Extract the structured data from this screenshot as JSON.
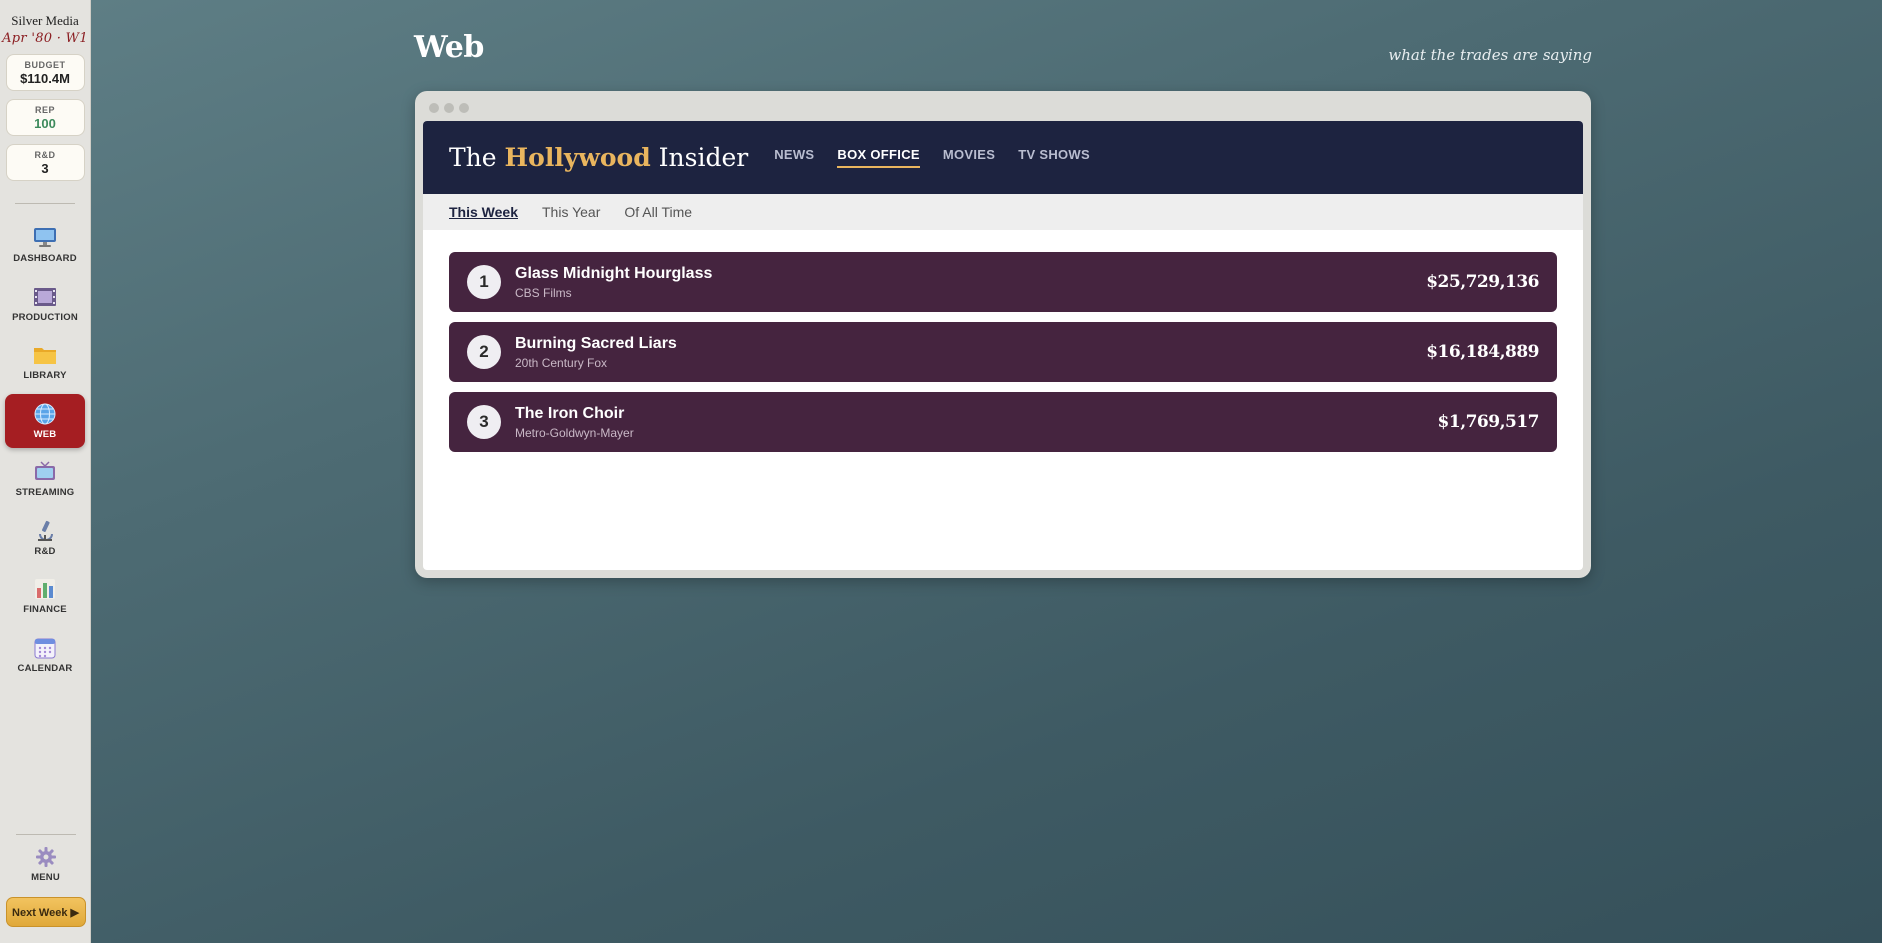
{
  "sidebar": {
    "studio_name": "Silver Media",
    "date": "Apr '80 · W1",
    "stats": {
      "budget_label": "BUDGET",
      "budget_value": "$110.4M",
      "rep_label": "REP",
      "rep_value": "100",
      "rnd_label": "R&D",
      "rnd_value": "3"
    },
    "nav": {
      "dashboard": "DASHBOARD",
      "production": "PRODUCTION",
      "library": "LIBRARY",
      "web": "WEB",
      "streaming": "STREAMING",
      "rnd": "R&D",
      "finance": "FINANCE",
      "calendar": "CALENDAR"
    },
    "menu_label": "MENU",
    "next_week_label": "Next Week ▶"
  },
  "page": {
    "title": "Web",
    "tagline": "what the trades are saying"
  },
  "site": {
    "logo_pre": "The ",
    "logo_accent": "Hollywood",
    "logo_post": " Insider",
    "nav": {
      "news": "NEWS",
      "box_office": "BOX OFFICE",
      "movies": "MOVIES",
      "tv_shows": "TV SHOWS"
    },
    "subtabs": {
      "this_week": "This Week",
      "this_year": "This Year",
      "all_time": "Of All Time"
    },
    "box_office": [
      {
        "rank": "1",
        "title": "Glass Midnight Hourglass",
        "studio": "CBS Films",
        "gross": "$25,729,136"
      },
      {
        "rank": "2",
        "title": "Burning Sacred Liars",
        "studio": "20th Century Fox",
        "gross": "$16,184,889"
      },
      {
        "rank": "3",
        "title": "The Iron Choir",
        "studio": "Metro-Goldwyn-Mayer",
        "gross": "$1,769,517"
      }
    ]
  },
  "colors": {
    "active_nav": "#a51e22",
    "site_header": "#1d2340",
    "accent_gold": "#e9b55e",
    "row_bg": "#45243f"
  }
}
